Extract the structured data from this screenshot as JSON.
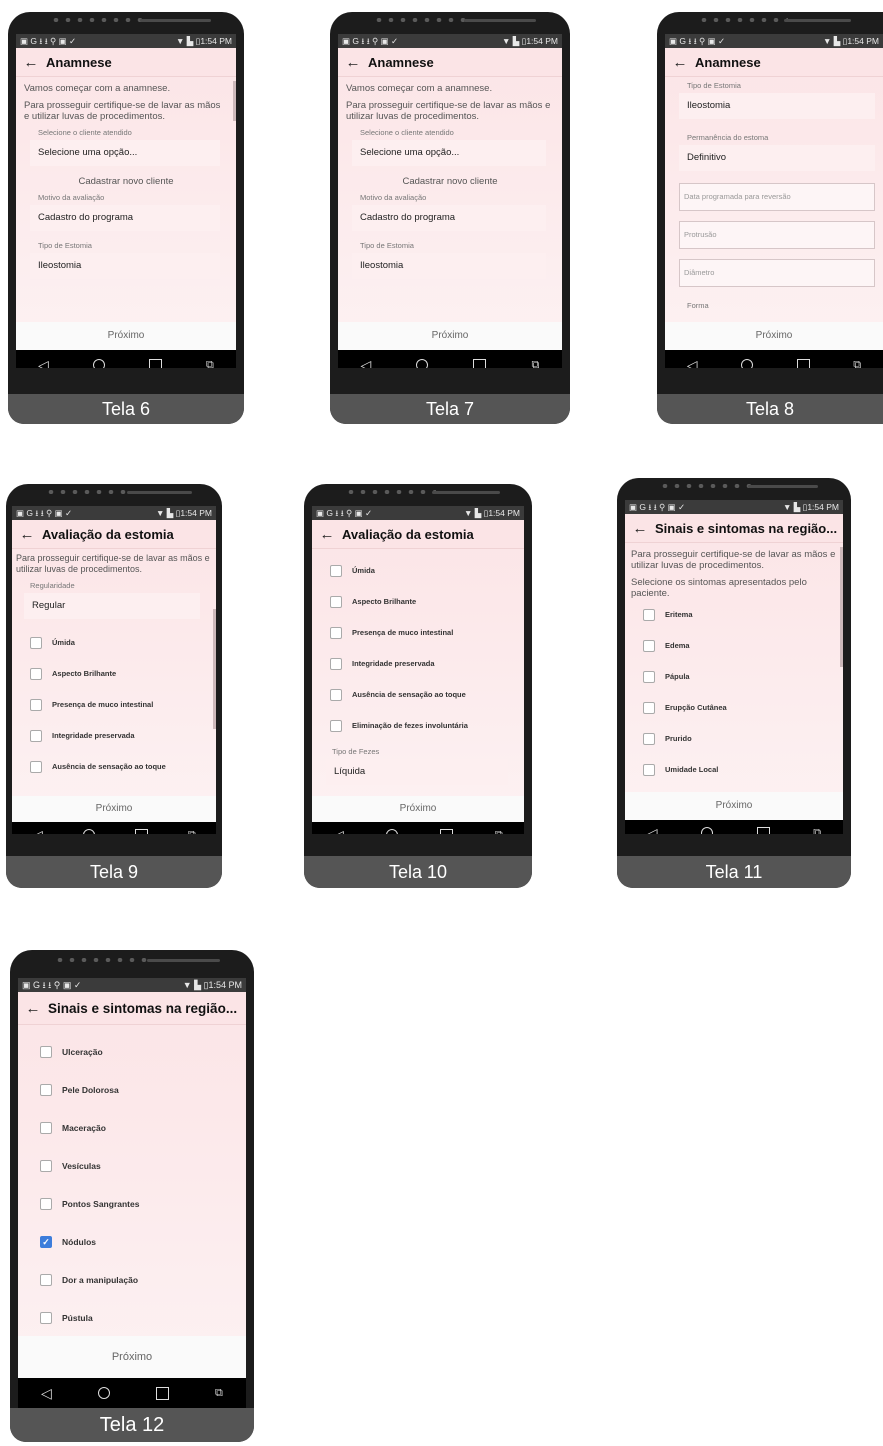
{
  "status": {
    "left": "▣ G ⭳ ⭳ ⚲ ▣ ✓",
    "right": "▼ ▙ ▯1:54 PM"
  },
  "common": {
    "back": "←",
    "next": "Próximo"
  },
  "nav": {
    "back": "◁",
    "home": "○",
    "recent": "☐",
    "switch": "⧉"
  },
  "screens": [
    {
      "caption": "Tela 6",
      "title": "Anamnese",
      "intro": "Vamos começar com a anamnese.",
      "para": "Para prosseguir certifique-se de lavar as mãos e utilizar luvas de procedimentos.",
      "client_label": "Selecione o cliente atendido",
      "client_value": "Selecione uma opção...",
      "register": "Cadastrar novo cliente",
      "reason_label": "Motivo da avaliação",
      "reason_value": "Cadastro do programa",
      "type_label": "Tipo de Estomia",
      "type_value": "Ileostomia"
    },
    {
      "caption": "Tela 7",
      "title": "Anamnese",
      "intro": "Vamos começar com a anamnese.",
      "para": "Para prosseguir certifique-se de lavar as mãos e utilizar luvas de procedimentos.",
      "client_label": "Selecione o cliente atendido",
      "client_value": "Selecione uma opção...",
      "register": "Cadastrar novo cliente",
      "reason_label": "Motivo da avaliação",
      "reason_value": "Cadastro do programa",
      "type_label": "Tipo de Estomia",
      "type_value": "Ileostomia"
    },
    {
      "caption": "Tela 8",
      "title": "Anamnese",
      "type_label": "Tipo de Estomia",
      "type_value": "Ileostomia",
      "perm_label": "Permanência do estoma",
      "perm_value": "Definitivo",
      "ph1": "Data programada para reversão",
      "ph2": "Protrusão",
      "ph3": "Diâmetro",
      "ph4": "Forma"
    },
    {
      "caption": "Tela 9",
      "title": "Avaliação da estomia",
      "para": "Para prosseguir certifique-se de lavar as mãos e utilizar luvas de procedimentos.",
      "reg_label": "Regularidade",
      "reg_value": "Regular",
      "items": [
        "Úmida",
        "Aspecto Brilhante",
        "Presença de muco intestinal",
        "Integridade preservada",
        "Ausência de sensação ao toque"
      ]
    },
    {
      "caption": "Tela 10",
      "title": "Avaliação da estomia",
      "items": [
        "Úmida",
        "Aspecto Brilhante",
        "Presença de muco intestinal",
        "Integridade preservada",
        "Ausência de sensação ao toque",
        "Eliminação de fezes involuntária"
      ],
      "fezes_label": "Tipo de Fezes",
      "fezes_value": "Líquida"
    },
    {
      "caption": "Tela 11",
      "title": "Sinais e sintomas na região...",
      "para": "Para prosseguir certifique-se de lavar as mãos e utilizar luvas de procedimentos.",
      "para2": "Selecione os sintomas apresentados pelo paciente.",
      "items": [
        "Eritema",
        "Edema",
        "Pápula",
        "Erupção Cutânea",
        "Prurido",
        "Umidade Local"
      ]
    },
    {
      "caption": "Tela 12",
      "title": "Sinais e sintomas na região...",
      "items": [
        "Ulceração",
        "Pele Dolorosa",
        "Maceração",
        "Vesículas",
        "Pontos Sangrantes",
        "Nódulos",
        "Dor a manipulação",
        "Pústula"
      ],
      "checked_item": "Nódulos"
    }
  ]
}
